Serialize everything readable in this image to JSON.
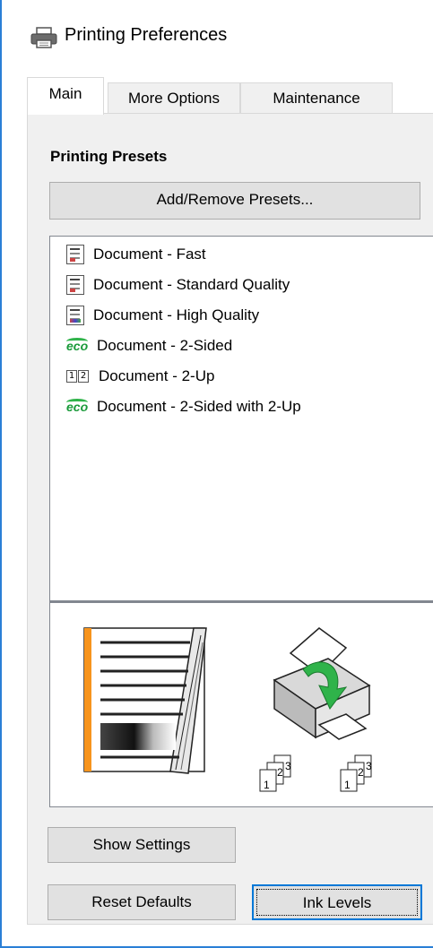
{
  "window": {
    "title": "Printing Preferences",
    "icon": "printer-icon"
  },
  "tabs": [
    {
      "label": "Main",
      "active": true
    },
    {
      "label": "More Options",
      "active": false
    },
    {
      "label": "Maintenance",
      "active": false
    }
  ],
  "main": {
    "section_title": "Printing Presets",
    "add_remove_label": "Add/Remove Presets...",
    "presets": [
      {
        "label": "Document - Fast",
        "icon": "document-icon"
      },
      {
        "label": "Document - Standard Quality",
        "icon": "document-icon"
      },
      {
        "label": "Document - High Quality",
        "icon": "document-color-icon"
      },
      {
        "label": "Document - 2-Sided",
        "icon": "eco-icon"
      },
      {
        "label": "Document - 2-Up",
        "icon": "two-up-icon"
      },
      {
        "label": "Document - 2-Sided with 2-Up",
        "icon": "eco-icon"
      }
    ],
    "eco_text": "eco",
    "two_up_digits": [
      "1",
      "2"
    ],
    "collate_digits": [
      "1",
      "2",
      "3"
    ],
    "accent_color": "#f7941d",
    "paper_arrow_color": "#2fb34a"
  },
  "buttons": {
    "show_settings": "Show Settings",
    "reset_defaults": "Reset Defaults",
    "ink_levels": "Ink Levels"
  }
}
